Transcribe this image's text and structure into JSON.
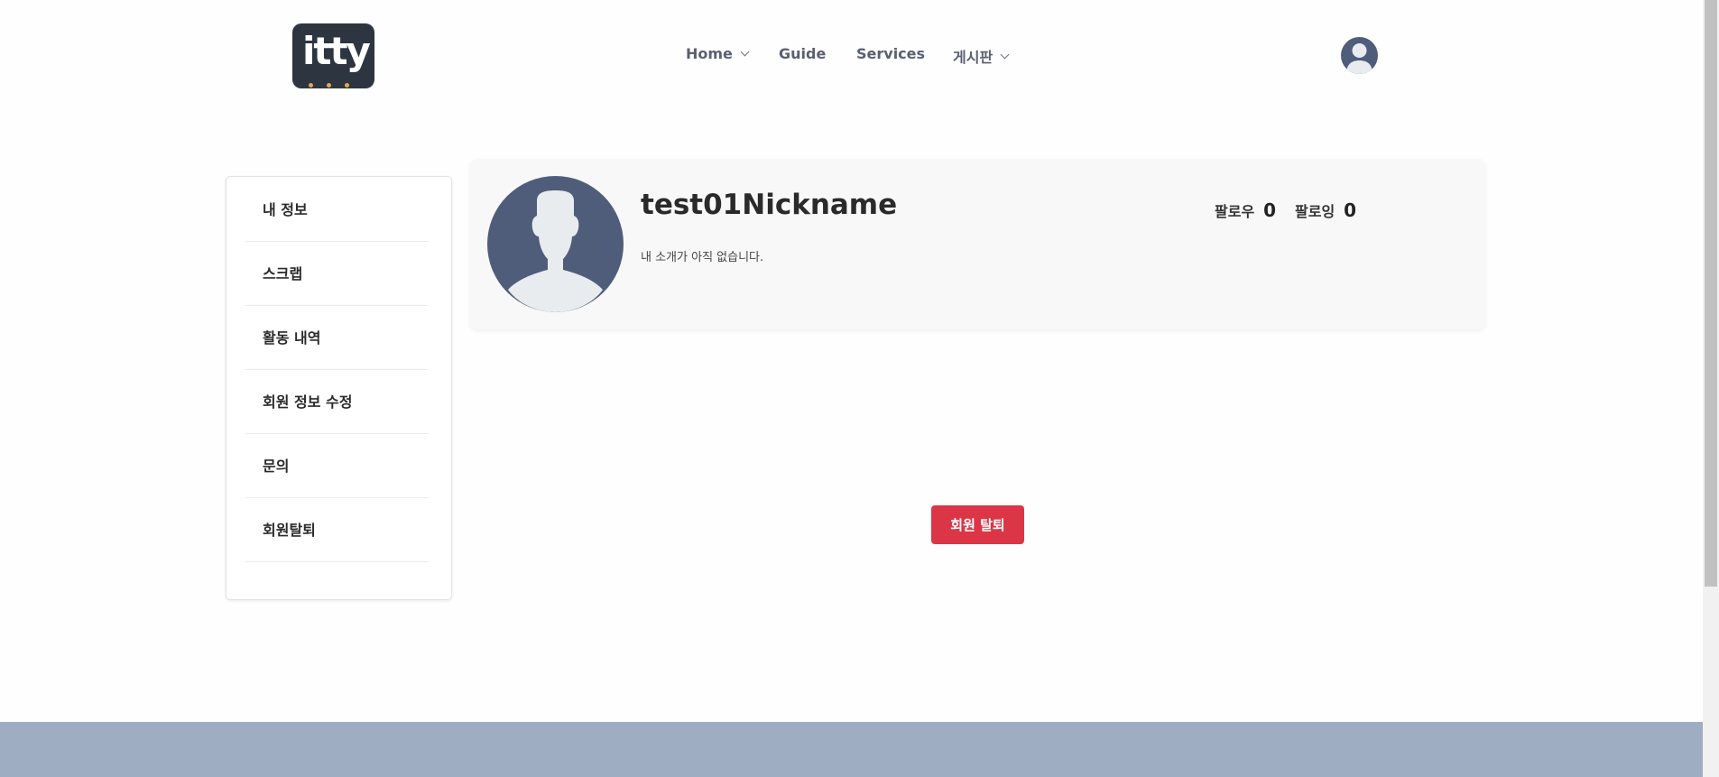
{
  "header": {
    "logo_text": "itty",
    "nav": [
      {
        "label": "Home",
        "has_dropdown": true
      },
      {
        "label": "Guide",
        "has_dropdown": false
      },
      {
        "label": "Services",
        "has_dropdown": false
      },
      {
        "label": "게시판",
        "has_dropdown": true
      }
    ],
    "avatar_icon": "user-avatar-icon"
  },
  "sidebar": {
    "items": [
      {
        "label": "내 정보"
      },
      {
        "label": "스크랩"
      },
      {
        "label": "활동 내역"
      },
      {
        "label": "회원 정보 수정"
      },
      {
        "label": "문의"
      },
      {
        "label": "회원탈퇴"
      }
    ]
  },
  "profile": {
    "nickname": "test01Nickname",
    "intro": "내 소개가 아직 없습니다.",
    "followers_label": "팔로우",
    "followers_count": "0",
    "following_label": "팔로잉",
    "following_count": "0"
  },
  "actions": {
    "withdraw_label": "회원 탈퇴"
  },
  "colors": {
    "accent_red": "#dc3545",
    "avatar_bg": "#4f5d7a",
    "footer_bg": "#9eadc2",
    "logo_bg": "#2c3540"
  }
}
